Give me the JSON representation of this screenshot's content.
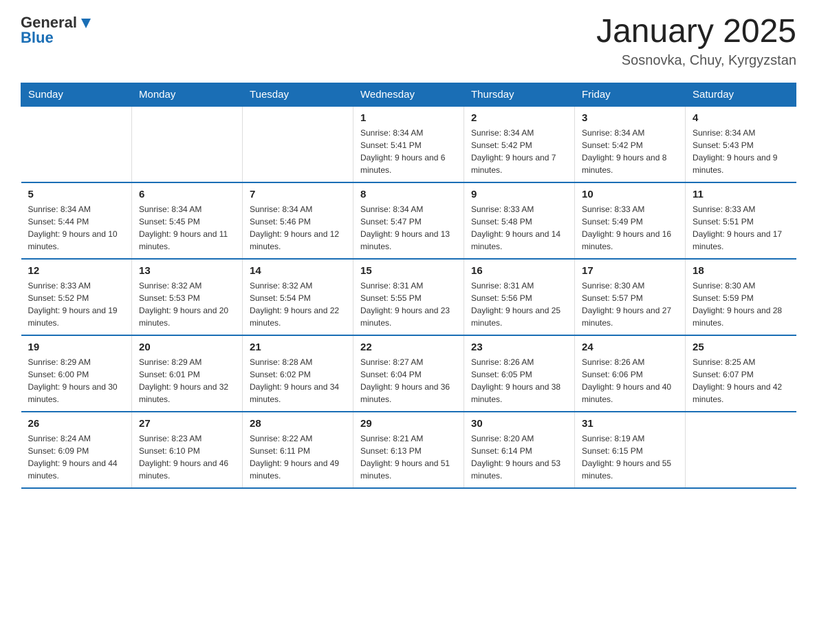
{
  "logo": {
    "general": "General",
    "blue": "Blue"
  },
  "header": {
    "title": "January 2025",
    "location": "Sosnovka, Chuy, Kyrgyzstan"
  },
  "days_of_week": [
    "Sunday",
    "Monday",
    "Tuesday",
    "Wednesday",
    "Thursday",
    "Friday",
    "Saturday"
  ],
  "weeks": [
    [
      {
        "day": "",
        "info": ""
      },
      {
        "day": "",
        "info": ""
      },
      {
        "day": "",
        "info": ""
      },
      {
        "day": "1",
        "info": "Sunrise: 8:34 AM\nSunset: 5:41 PM\nDaylight: 9 hours and 6 minutes."
      },
      {
        "day": "2",
        "info": "Sunrise: 8:34 AM\nSunset: 5:42 PM\nDaylight: 9 hours and 7 minutes."
      },
      {
        "day": "3",
        "info": "Sunrise: 8:34 AM\nSunset: 5:42 PM\nDaylight: 9 hours and 8 minutes."
      },
      {
        "day": "4",
        "info": "Sunrise: 8:34 AM\nSunset: 5:43 PM\nDaylight: 9 hours and 9 minutes."
      }
    ],
    [
      {
        "day": "5",
        "info": "Sunrise: 8:34 AM\nSunset: 5:44 PM\nDaylight: 9 hours and 10 minutes."
      },
      {
        "day": "6",
        "info": "Sunrise: 8:34 AM\nSunset: 5:45 PM\nDaylight: 9 hours and 11 minutes."
      },
      {
        "day": "7",
        "info": "Sunrise: 8:34 AM\nSunset: 5:46 PM\nDaylight: 9 hours and 12 minutes."
      },
      {
        "day": "8",
        "info": "Sunrise: 8:34 AM\nSunset: 5:47 PM\nDaylight: 9 hours and 13 minutes."
      },
      {
        "day": "9",
        "info": "Sunrise: 8:33 AM\nSunset: 5:48 PM\nDaylight: 9 hours and 14 minutes."
      },
      {
        "day": "10",
        "info": "Sunrise: 8:33 AM\nSunset: 5:49 PM\nDaylight: 9 hours and 16 minutes."
      },
      {
        "day": "11",
        "info": "Sunrise: 8:33 AM\nSunset: 5:51 PM\nDaylight: 9 hours and 17 minutes."
      }
    ],
    [
      {
        "day": "12",
        "info": "Sunrise: 8:33 AM\nSunset: 5:52 PM\nDaylight: 9 hours and 19 minutes."
      },
      {
        "day": "13",
        "info": "Sunrise: 8:32 AM\nSunset: 5:53 PM\nDaylight: 9 hours and 20 minutes."
      },
      {
        "day": "14",
        "info": "Sunrise: 8:32 AM\nSunset: 5:54 PM\nDaylight: 9 hours and 22 minutes."
      },
      {
        "day": "15",
        "info": "Sunrise: 8:31 AM\nSunset: 5:55 PM\nDaylight: 9 hours and 23 minutes."
      },
      {
        "day": "16",
        "info": "Sunrise: 8:31 AM\nSunset: 5:56 PM\nDaylight: 9 hours and 25 minutes."
      },
      {
        "day": "17",
        "info": "Sunrise: 8:30 AM\nSunset: 5:57 PM\nDaylight: 9 hours and 27 minutes."
      },
      {
        "day": "18",
        "info": "Sunrise: 8:30 AM\nSunset: 5:59 PM\nDaylight: 9 hours and 28 minutes."
      }
    ],
    [
      {
        "day": "19",
        "info": "Sunrise: 8:29 AM\nSunset: 6:00 PM\nDaylight: 9 hours and 30 minutes."
      },
      {
        "day": "20",
        "info": "Sunrise: 8:29 AM\nSunset: 6:01 PM\nDaylight: 9 hours and 32 minutes."
      },
      {
        "day": "21",
        "info": "Sunrise: 8:28 AM\nSunset: 6:02 PM\nDaylight: 9 hours and 34 minutes."
      },
      {
        "day": "22",
        "info": "Sunrise: 8:27 AM\nSunset: 6:04 PM\nDaylight: 9 hours and 36 minutes."
      },
      {
        "day": "23",
        "info": "Sunrise: 8:26 AM\nSunset: 6:05 PM\nDaylight: 9 hours and 38 minutes."
      },
      {
        "day": "24",
        "info": "Sunrise: 8:26 AM\nSunset: 6:06 PM\nDaylight: 9 hours and 40 minutes."
      },
      {
        "day": "25",
        "info": "Sunrise: 8:25 AM\nSunset: 6:07 PM\nDaylight: 9 hours and 42 minutes."
      }
    ],
    [
      {
        "day": "26",
        "info": "Sunrise: 8:24 AM\nSunset: 6:09 PM\nDaylight: 9 hours and 44 minutes."
      },
      {
        "day": "27",
        "info": "Sunrise: 8:23 AM\nSunset: 6:10 PM\nDaylight: 9 hours and 46 minutes."
      },
      {
        "day": "28",
        "info": "Sunrise: 8:22 AM\nSunset: 6:11 PM\nDaylight: 9 hours and 49 minutes."
      },
      {
        "day": "29",
        "info": "Sunrise: 8:21 AM\nSunset: 6:13 PM\nDaylight: 9 hours and 51 minutes."
      },
      {
        "day": "30",
        "info": "Sunrise: 8:20 AM\nSunset: 6:14 PM\nDaylight: 9 hours and 53 minutes."
      },
      {
        "day": "31",
        "info": "Sunrise: 8:19 AM\nSunset: 6:15 PM\nDaylight: 9 hours and 55 minutes."
      },
      {
        "day": "",
        "info": ""
      }
    ]
  ]
}
